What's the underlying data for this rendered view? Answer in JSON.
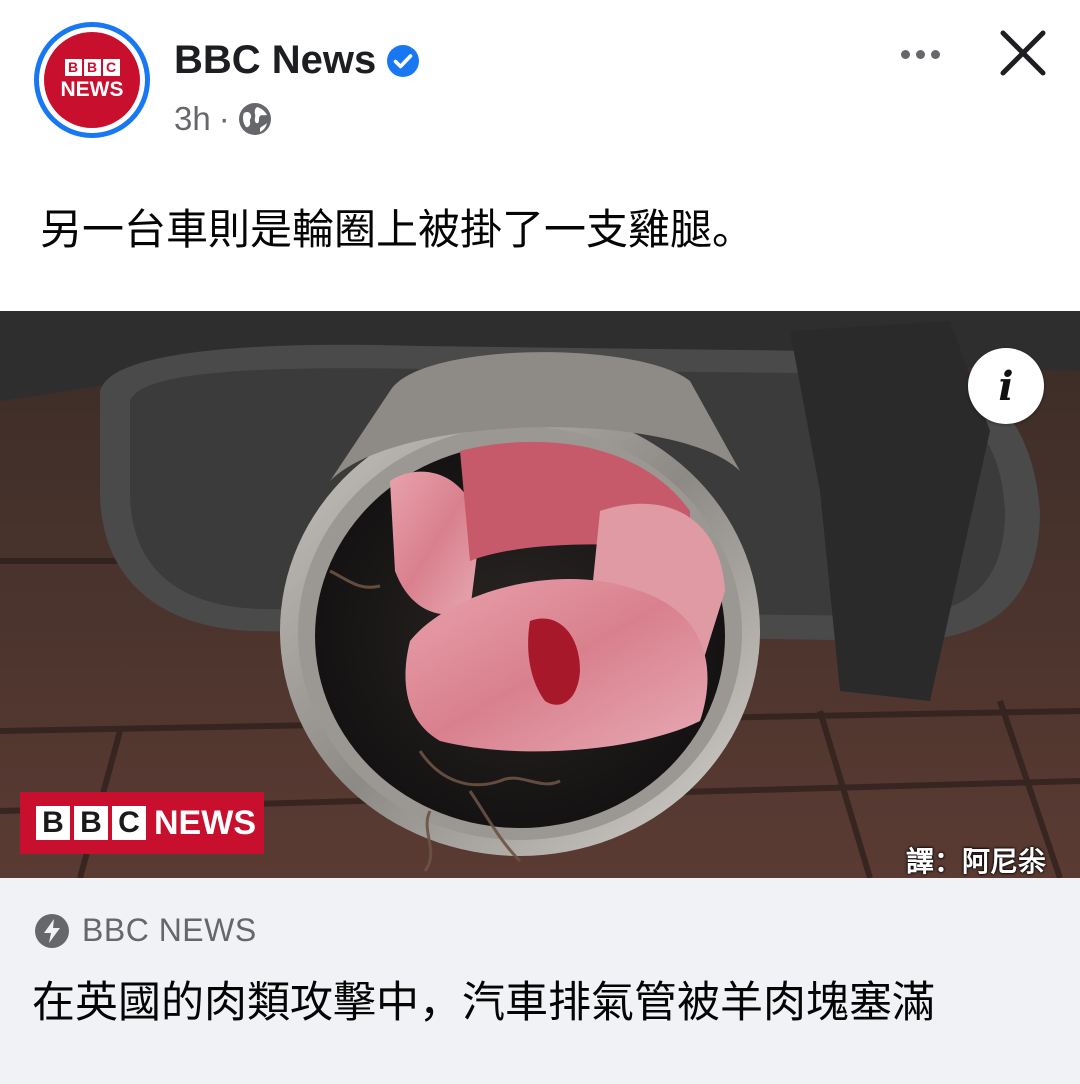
{
  "header": {
    "avatar_label_top": [
      "B",
      "B",
      "C"
    ],
    "avatar_label_bottom": "NEWS",
    "page_name": "BBC News",
    "timestamp": "3h",
    "separator": "·",
    "privacy_icon": "globe-icon",
    "verified_icon": "verified-badge-icon",
    "more_icon": "more-options-icon",
    "close_icon": "close-icon"
  },
  "post": {
    "caption": "另一台車則是輪圈上被掛了一支雞腿。"
  },
  "photo": {
    "info_icon": "info-icon",
    "info_glyph": "i",
    "watermark_letters": [
      "B",
      "B",
      "C"
    ],
    "watermark_news": "NEWS",
    "translator_credit": "譯：阿尼尜"
  },
  "link_preview": {
    "source_icon": "lightning-bolt-icon",
    "source": "BBC NEWS",
    "headline": "在英國的肉類攻擊中，汽車排氣管被羊肉塊塞滿"
  },
  "colors": {
    "facebook_blue": "#1877f2",
    "bbc_red": "#c8102e",
    "secondary_text": "#65676b",
    "card_background": "#f0f2f5"
  }
}
